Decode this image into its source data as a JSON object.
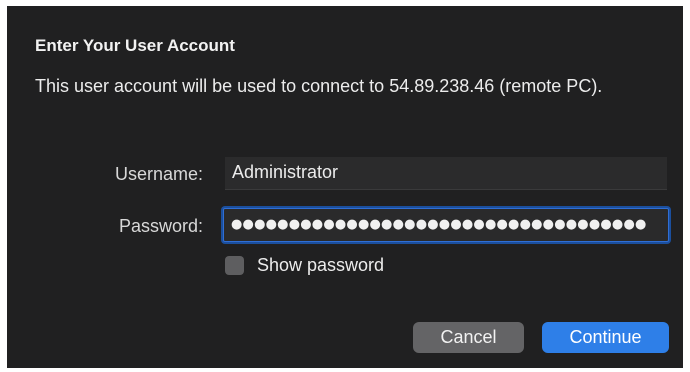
{
  "dialog": {
    "title": "Enter Your User Account",
    "message": "This user account will be used to connect to 54.89.238.46 (remote PC).",
    "username": {
      "label": "Username:",
      "value": "Administrator"
    },
    "password": {
      "label": "Password:",
      "masked_value": "●●●●●●●●●●●●●●●●●●●●●●●●●●●●●●●●●●●●"
    },
    "show_password": {
      "label": "Show password",
      "checked": false
    },
    "buttons": {
      "cancel": "Cancel",
      "continue": "Continue"
    }
  },
  "colors": {
    "background": "#202021",
    "accent": "#2e7fe8",
    "cancel_button": "#646466",
    "focus_ring": "#2f6ed5"
  }
}
